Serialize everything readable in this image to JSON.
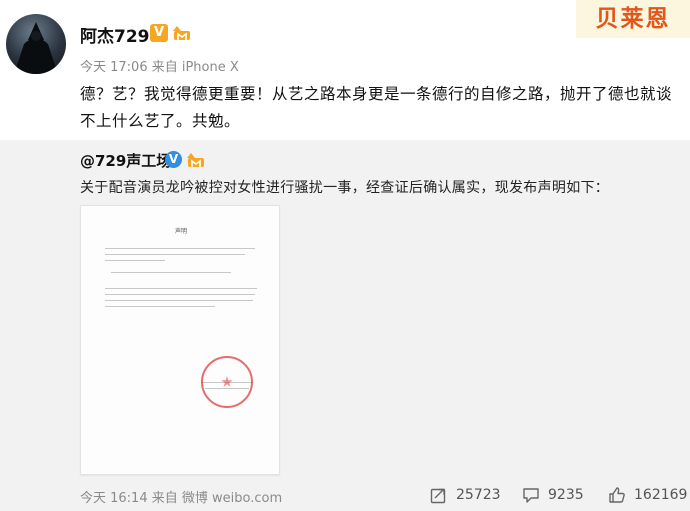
{
  "post": {
    "username": "阿杰729",
    "verified_badge": "V",
    "meta": "今天 17:06 来自 iPhone X",
    "text": "德？艺？我觉得德更重要！从艺之路本身更是一条德行的自修之路，抛开了德也就谈不上什么艺了。共勉。"
  },
  "watermark": "贝莱恩",
  "repost": {
    "author": "@729声工场",
    "verified_badge": "V",
    "text": "关于配音演员龙吟被控对女性进行骚扰一事，经查证后确认属实，现发布声明如下：",
    "attachment": {
      "title": "声明"
    },
    "meta": "今天 16:14 来自 微博 weibo.com",
    "stats": {
      "reposts": "25723",
      "comments": "9235",
      "likes": "162169"
    }
  },
  "colors": {
    "accent_orange": "#f5a623",
    "verified_blue": "#2f8fe0",
    "seal_red": "#dc3c3c",
    "watermark_text": "#e0561b"
  },
  "icons": [
    "avatar-image",
    "member-badge-icon",
    "repost-icon",
    "comment-icon",
    "like-icon"
  ]
}
